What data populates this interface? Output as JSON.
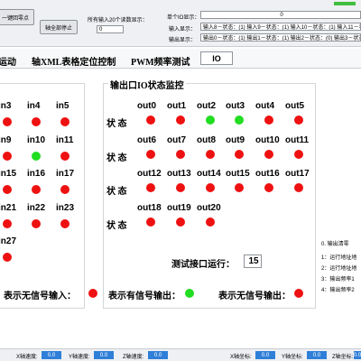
{
  "top": {
    "btn_zero": "一键回零点",
    "btn_stop": "轴全部停止",
    "input_label": "所有输入20个读数显示：",
    "input_value": "0",
    "reg_label": "单个IO显示：",
    "reg_value": "0",
    "input_disp_label": "输入显示：",
    "input_disp_value": "输入8－状态：(1)  输入9－状态：(1)  输入10－状态：(1)  输入11－状态：(1)",
    "output_disp_label": "输出显示：",
    "output_disp_value": "输出0－状态：(1)  输出1－状态：(1)  输出2－状态：(0)  输出3－状态：(0)"
  },
  "tabs": [
    {
      "label": "运动"
    },
    {
      "label": "轴XML表格定位控制"
    },
    {
      "label": "PWM频率测试"
    },
    {
      "label": "IO"
    }
  ],
  "input_panel": {
    "rows": [
      [
        "in3",
        "in4",
        "in5"
      ],
      [
        "in9",
        "in10",
        "in11"
      ],
      [
        "in15",
        "in16",
        "in17"
      ],
      [
        "in21",
        "in22",
        "in23"
      ],
      [
        "in27"
      ]
    ],
    "states": [
      [
        "red",
        "red",
        "red"
      ],
      [
        "red",
        "green",
        "red"
      ],
      [
        "red",
        "red",
        "red"
      ],
      [
        "red",
        "red",
        "red"
      ],
      [
        "red"
      ]
    ],
    "legend": "表示无信号输入："
  },
  "output_panel": {
    "title": "输出口IO状态监控",
    "state_label": "状 态",
    "rows": [
      [
        "out0",
        "out1",
        "out2",
        "out3",
        "out4",
        "out5"
      ],
      [
        "out6",
        "out7",
        "out8",
        "out9",
        "out10",
        "out11"
      ],
      [
        "out12",
        "out13",
        "out14",
        "out15",
        "out16",
        "out17"
      ],
      [
        "out18",
        "out19",
        "out20"
      ]
    ],
    "states": [
      [
        "red",
        "red",
        "green",
        "green",
        "red",
        "red"
      ],
      [
        "red",
        "red",
        "red",
        "red",
        "red",
        "red"
      ],
      [
        "red",
        "red",
        "red",
        "red",
        "red",
        "red"
      ],
      [
        "red",
        "red",
        "red"
      ]
    ],
    "test_label": "测试接口运行：",
    "test_value": "15",
    "legend_on": "表示有信号输出：",
    "legend_off": "表示无信号输出："
  },
  "notes": [
    "0. 输出清零",
    "1：运行地址地",
    "2：运行地址地",
    "3：输出频率1",
    "4：输出频率2"
  ],
  "bottom": {
    "x_speed_label": "X轴速度:",
    "x_speed": "0.0",
    "y_speed_label": "Y轴速度:",
    "y_speed": "0.0",
    "z_speed_label": "Z轴速度:",
    "z_speed": "0.0",
    "x_pos_label": "X轴坐标:",
    "x_pos": "0.0",
    "y_pos_label": "Y轴坐标:",
    "y_pos": "0.0",
    "z_pos_label": "Z轴坐标:",
    "z_pos": "0.0"
  },
  "colors": {
    "red": "#ee1111",
    "green": "#22dd22",
    "accent": "#2f7fd8"
  }
}
